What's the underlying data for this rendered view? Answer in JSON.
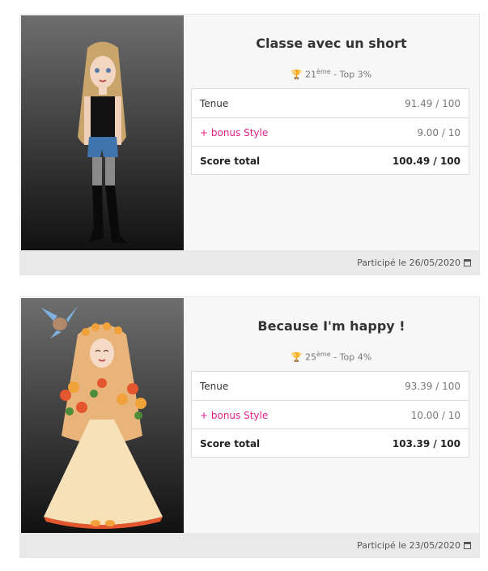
{
  "entries": [
    {
      "title": "Classe avec un short",
      "rank_number": "21",
      "rank_suffix": "ème",
      "rank_top": " - Top 3%",
      "rows": [
        {
          "label": "Tenue",
          "value": "91.49 / 100"
        },
        {
          "label": "+ bonus Style",
          "value": "9.00 / 10"
        },
        {
          "label": "Score total",
          "value": "100.49 / 100"
        }
      ],
      "participation": "Participé le 26/05/2020"
    },
    {
      "title": "Because I'm happy !",
      "rank_number": "25",
      "rank_suffix": "ème",
      "rank_top": " - Top 4%",
      "rows": [
        {
          "label": "Tenue",
          "value": "93.39 / 100"
        },
        {
          "label": "+ bonus Style",
          "value": "10.00 / 10"
        },
        {
          "label": "Score total",
          "value": "103.39 / 100"
        }
      ],
      "participation": "Participé le 23/05/2020"
    }
  ],
  "colors": {
    "bonus": "#e0218a",
    "card_bg": "#f7f7f7"
  },
  "icons": {
    "rank": "trophy-icon",
    "date": "calendar-icon"
  }
}
